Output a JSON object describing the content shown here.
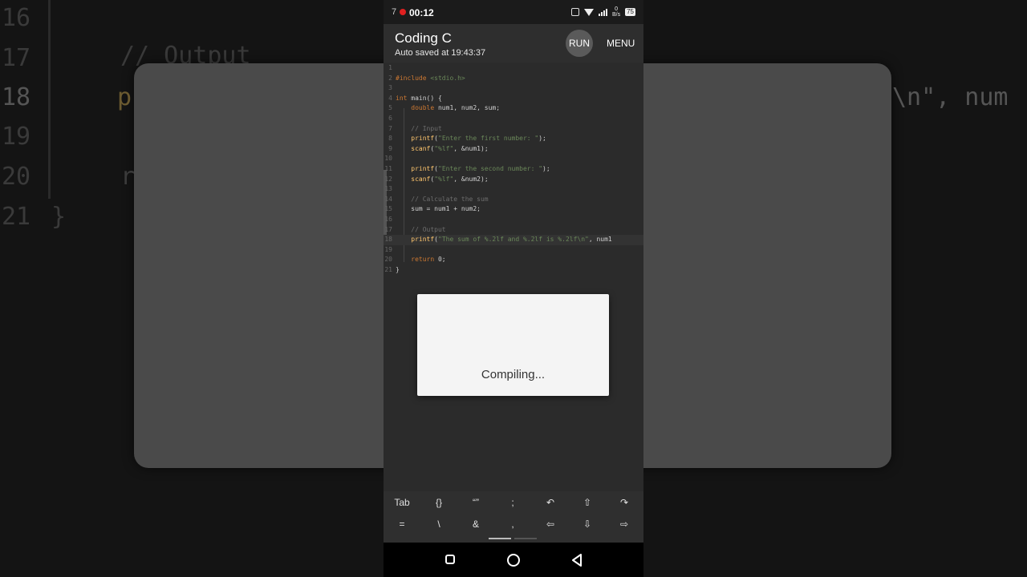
{
  "background": {
    "lines": [
      {
        "num": "16",
        "text": ""
      },
      {
        "num": "17",
        "text": "// Output"
      },
      {
        "num": "18",
        "text": "p"
      },
      {
        "num": "19",
        "text": ""
      },
      {
        "num": "20",
        "text": "r"
      },
      {
        "num": "21",
        "text": "}"
      }
    ],
    "right_text": "\\n\", num"
  },
  "status_bar": {
    "left_digit": "7",
    "time": "00:12",
    "net_rate_value": "0",
    "net_rate_unit": "B/s",
    "battery": "75"
  },
  "app": {
    "title": "Coding C",
    "subtitle": "Auto saved at 19:43:37",
    "run_label": "RUN",
    "menu_label": "MENU"
  },
  "editor": {
    "lines": [
      {
        "num": "1",
        "code": ""
      },
      {
        "num": "2",
        "code": "#include <stdio.h>"
      },
      {
        "num": "3",
        "code": ""
      },
      {
        "num": "4",
        "code": "int main() {"
      },
      {
        "num": "5",
        "code": "    double num1, num2, sum;"
      },
      {
        "num": "6",
        "code": ""
      },
      {
        "num": "7",
        "code": "    // Input"
      },
      {
        "num": "8",
        "code": "    printf(\"Enter the first number: \");"
      },
      {
        "num": "9",
        "code": "    scanf(\"%lf\", &num1);"
      },
      {
        "num": "10",
        "code": ""
      },
      {
        "num": "11",
        "code": "    printf(\"Enter the second number: \");"
      },
      {
        "num": "12",
        "code": "    scanf(\"%lf\", &num2);"
      },
      {
        "num": "13",
        "code": ""
      },
      {
        "num": "14",
        "code": "    // Calculate the sum"
      },
      {
        "num": "15",
        "code": "    sum = num1 + num2;"
      },
      {
        "num": "16",
        "code": ""
      },
      {
        "num": "17",
        "code": "    // Output"
      },
      {
        "num": "18",
        "code": "    printf(\"The sum of %.2lf and %.2lf is %.2lf\\n\", num1"
      },
      {
        "num": "19",
        "code": ""
      },
      {
        "num": "20",
        "code": "    return 0;"
      },
      {
        "num": "21",
        "code": "}"
      }
    ]
  },
  "dialog": {
    "message": "Compiling..."
  },
  "keybar": {
    "row1": [
      "Tab",
      "{}",
      "“”",
      ";",
      "↶",
      "⇧",
      "↷"
    ],
    "row2": [
      "=",
      "\\",
      "&",
      ",",
      "⇦",
      "⇩",
      "⇨"
    ]
  },
  "colors": {
    "keyword": "#cc7832",
    "string": "#6a8759",
    "comment": "#6d6d6d",
    "function": "#ffc66d"
  }
}
